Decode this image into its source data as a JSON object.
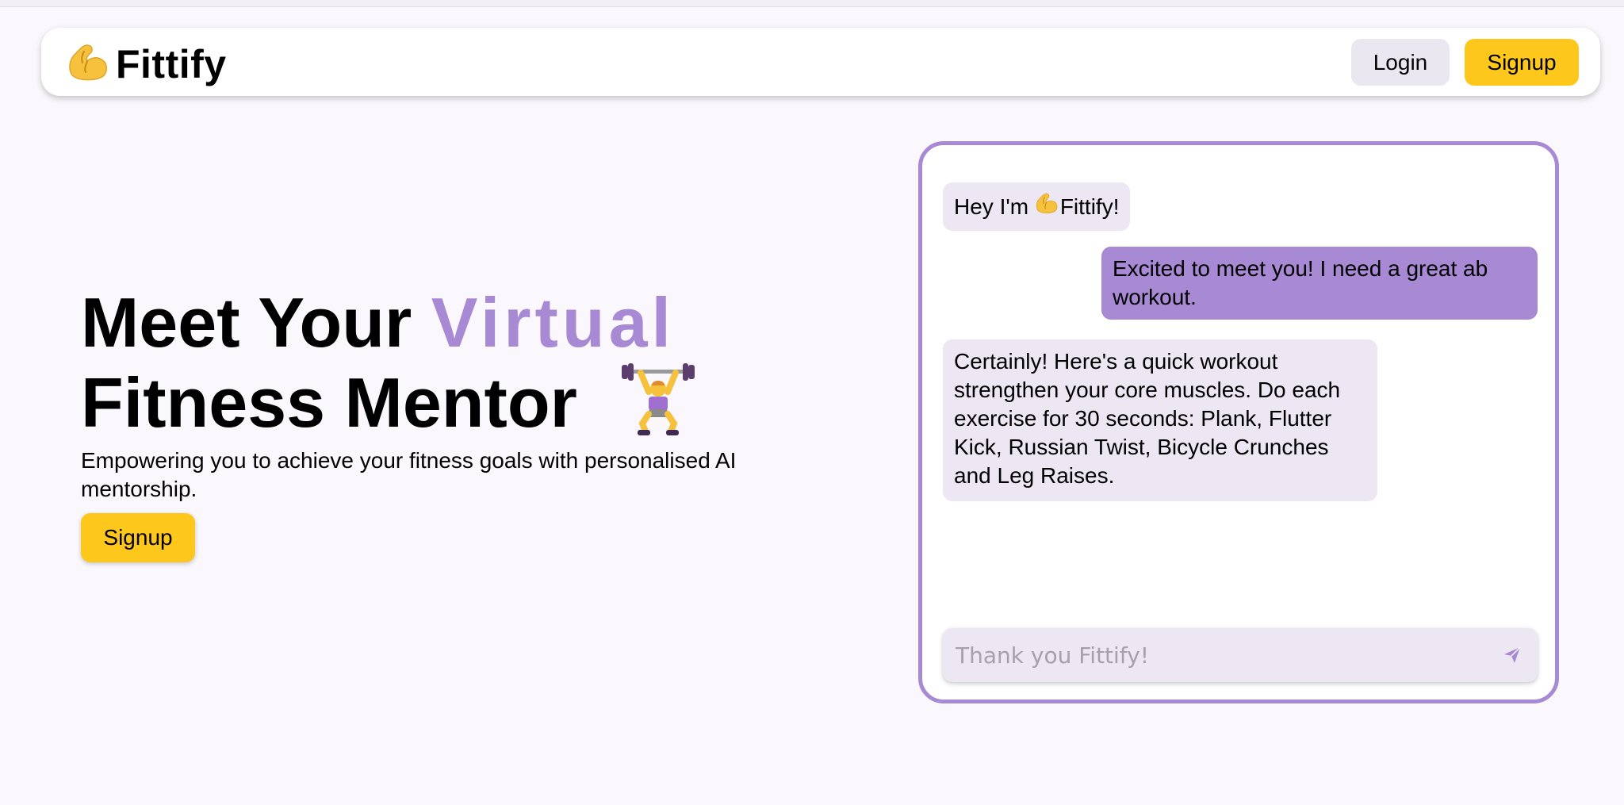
{
  "colors": {
    "page_bg": "#faf8fd",
    "accent_purple": "#a889d4",
    "button_yellow": "#fdc81b",
    "bubble_bot": "#ece7f2",
    "bubble_user": "#a889d4"
  },
  "navbar": {
    "logo_icon": "flexed-biceps-icon",
    "brand": "Fittify",
    "login_label": "Login",
    "signup_label": "Signup"
  },
  "hero": {
    "title_part1": "Meet Your ",
    "title_accent": "Virtual",
    "title_part2": "Fitness Mentor",
    "title_icon": "weightlifter-icon",
    "subtitle": "Empowering you to achieve your fitness goals with personalised AI mentorship.",
    "signup_label": "Signup"
  },
  "chat": {
    "messages": [
      {
        "role": "bot",
        "text_before": "Hey I'm ",
        "icon": "flexed-biceps-icon",
        "text_after": "Fittify!"
      },
      {
        "role": "user",
        "text": "Excited to meet you! I need a great ab workout."
      },
      {
        "role": "bot",
        "text": "Certainly! Here's a quick workout strengthen your core muscles. Do each exercise for 30 seconds: Plank, Flutter Kick, Russian Twist, Bicycle Crunches and Leg Raises."
      }
    ],
    "input_value": "Thank you Fittify!",
    "send_icon": "send-icon"
  }
}
